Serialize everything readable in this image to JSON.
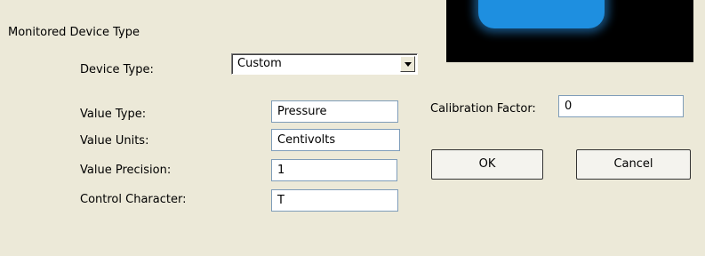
{
  "section": {
    "title": "Monitored Device Type"
  },
  "device_type": {
    "label": "Device Type:",
    "value": "Custom"
  },
  "value_type": {
    "label": "Value Type:",
    "value": "Pressure"
  },
  "value_units": {
    "label": "Value Units:",
    "value": "Centivolts"
  },
  "value_precision": {
    "label": "Value Precision:",
    "value": "1"
  },
  "control_character": {
    "label": "Control Character:",
    "value": "T"
  },
  "calibration_factor": {
    "label": "Calibration Factor:",
    "value": "0"
  },
  "buttons": {
    "ok": "OK",
    "cancel": "Cancel"
  },
  "colors": {
    "background": "#ECE9D8",
    "field_border": "#7F9DB9",
    "preview_bg": "#000000",
    "preview_glow": "#1E8FE0"
  },
  "icons": {
    "dropdown": "chevron-down-icon"
  }
}
